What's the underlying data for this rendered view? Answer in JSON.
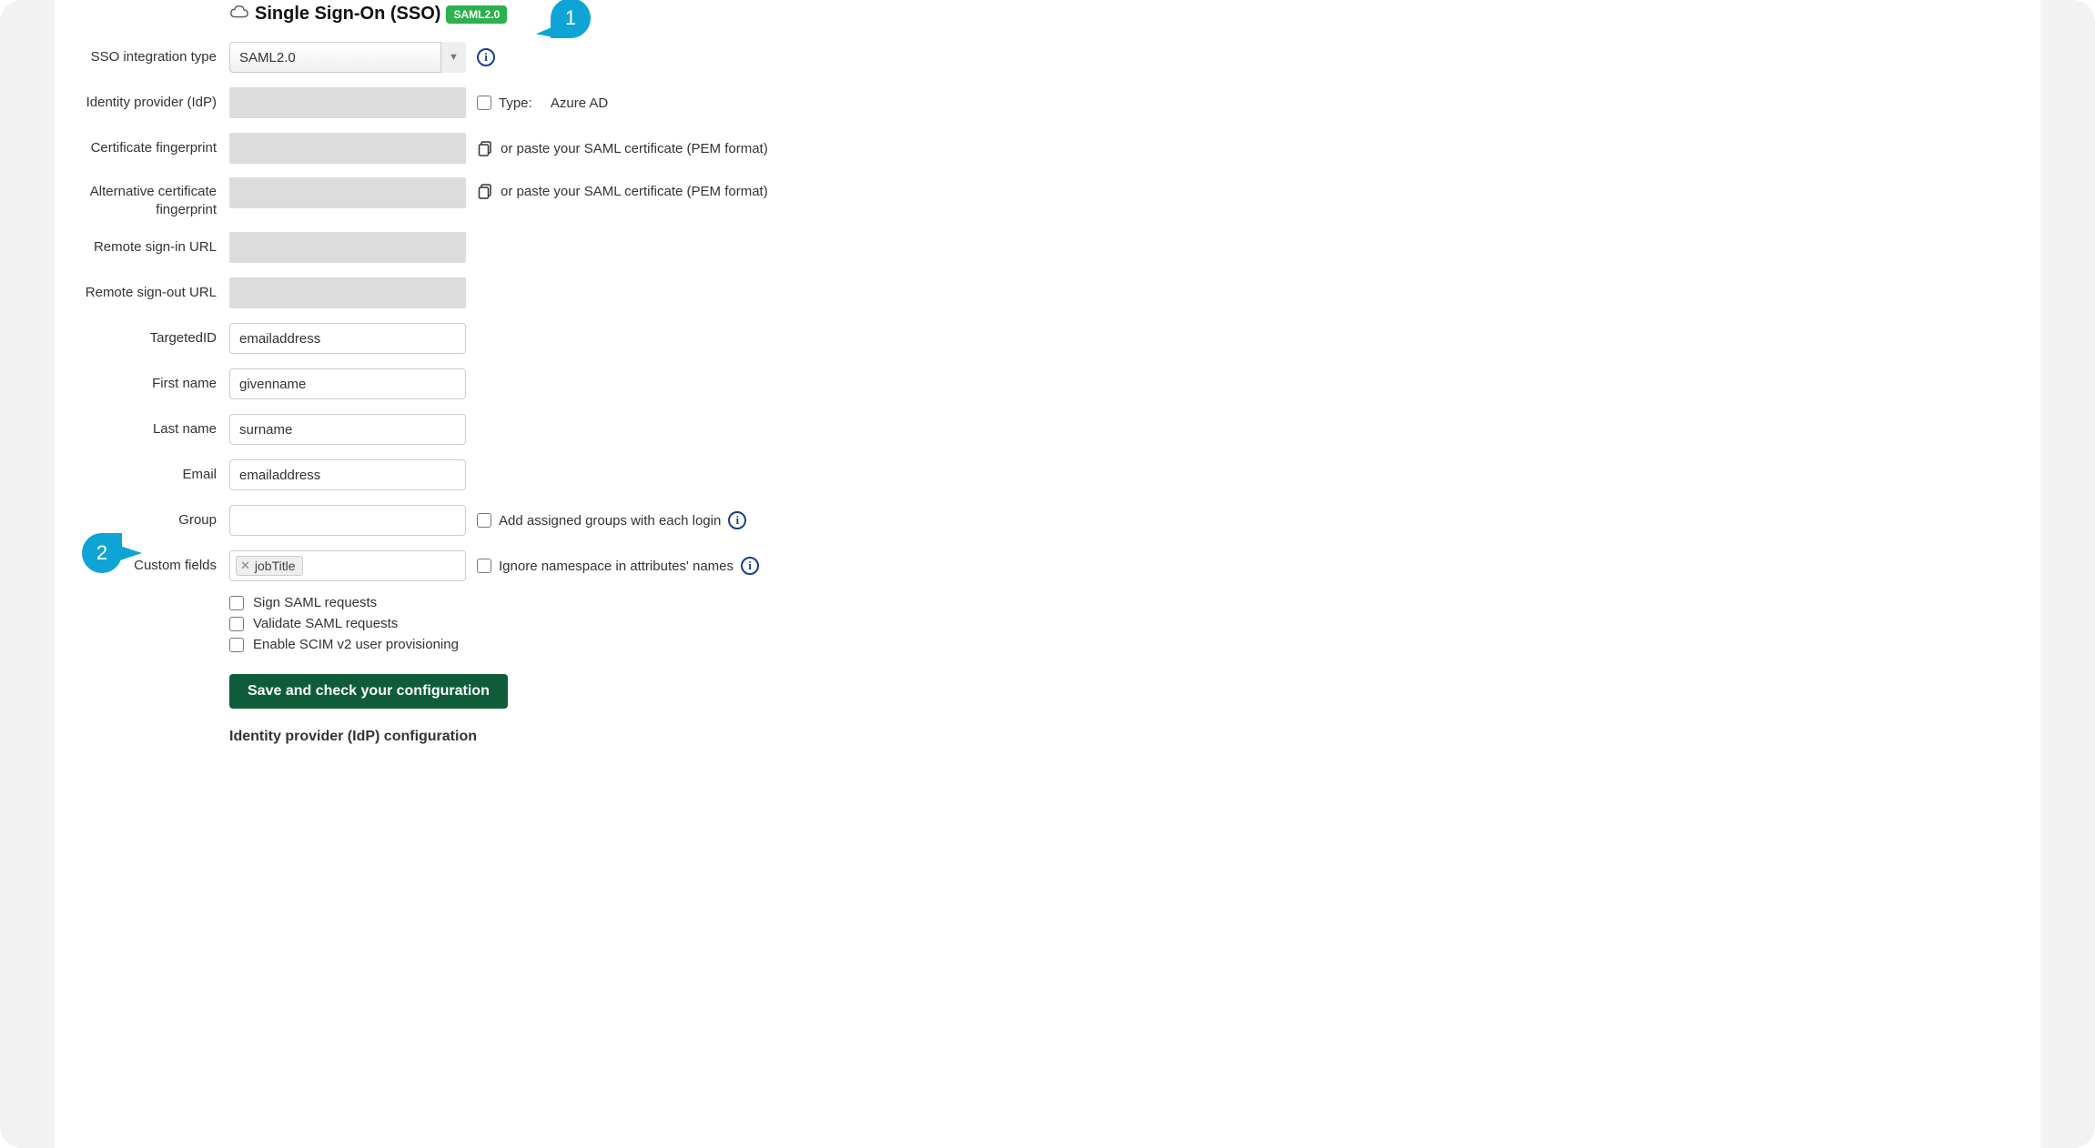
{
  "header": {
    "title": "Single Sign-On (SSO)",
    "badge": "SAML2.0"
  },
  "callouts": {
    "one": "1",
    "two": "2"
  },
  "fields": {
    "sso_type": {
      "label": "SSO integration type",
      "value": "SAML2.0"
    },
    "idp": {
      "label": "Identity provider (IdP)",
      "type_label": "Type:",
      "type_value": "Azure AD"
    },
    "cert": {
      "label": "Certificate fingerprint",
      "hint": "or paste your SAML certificate (PEM format)"
    },
    "alt_cert": {
      "label": "Alternative certificate fingerprint",
      "hint": "or paste your SAML certificate (PEM format)"
    },
    "signin": {
      "label": "Remote sign-in URL"
    },
    "signout": {
      "label": "Remote sign-out URL"
    },
    "targeted": {
      "label": "TargetedID",
      "value": "emailaddress"
    },
    "first": {
      "label": "First name",
      "value": "givenname"
    },
    "last": {
      "label": "Last name",
      "value": "surname"
    },
    "email": {
      "label": "Email",
      "value": "emailaddress"
    },
    "group": {
      "label": "Group",
      "aux": "Add assigned groups with each login"
    },
    "custom": {
      "label": "Custom fields",
      "tag": "jobTitle",
      "aux": "Ignore namespace in attributes' names"
    }
  },
  "options": {
    "sign": "Sign SAML requests",
    "validate": "Validate SAML requests",
    "scim": "Enable SCIM v2 user provisioning"
  },
  "save_button": "Save and check your configuration",
  "idp_config_heading": "Identity provider (IdP) configuration"
}
